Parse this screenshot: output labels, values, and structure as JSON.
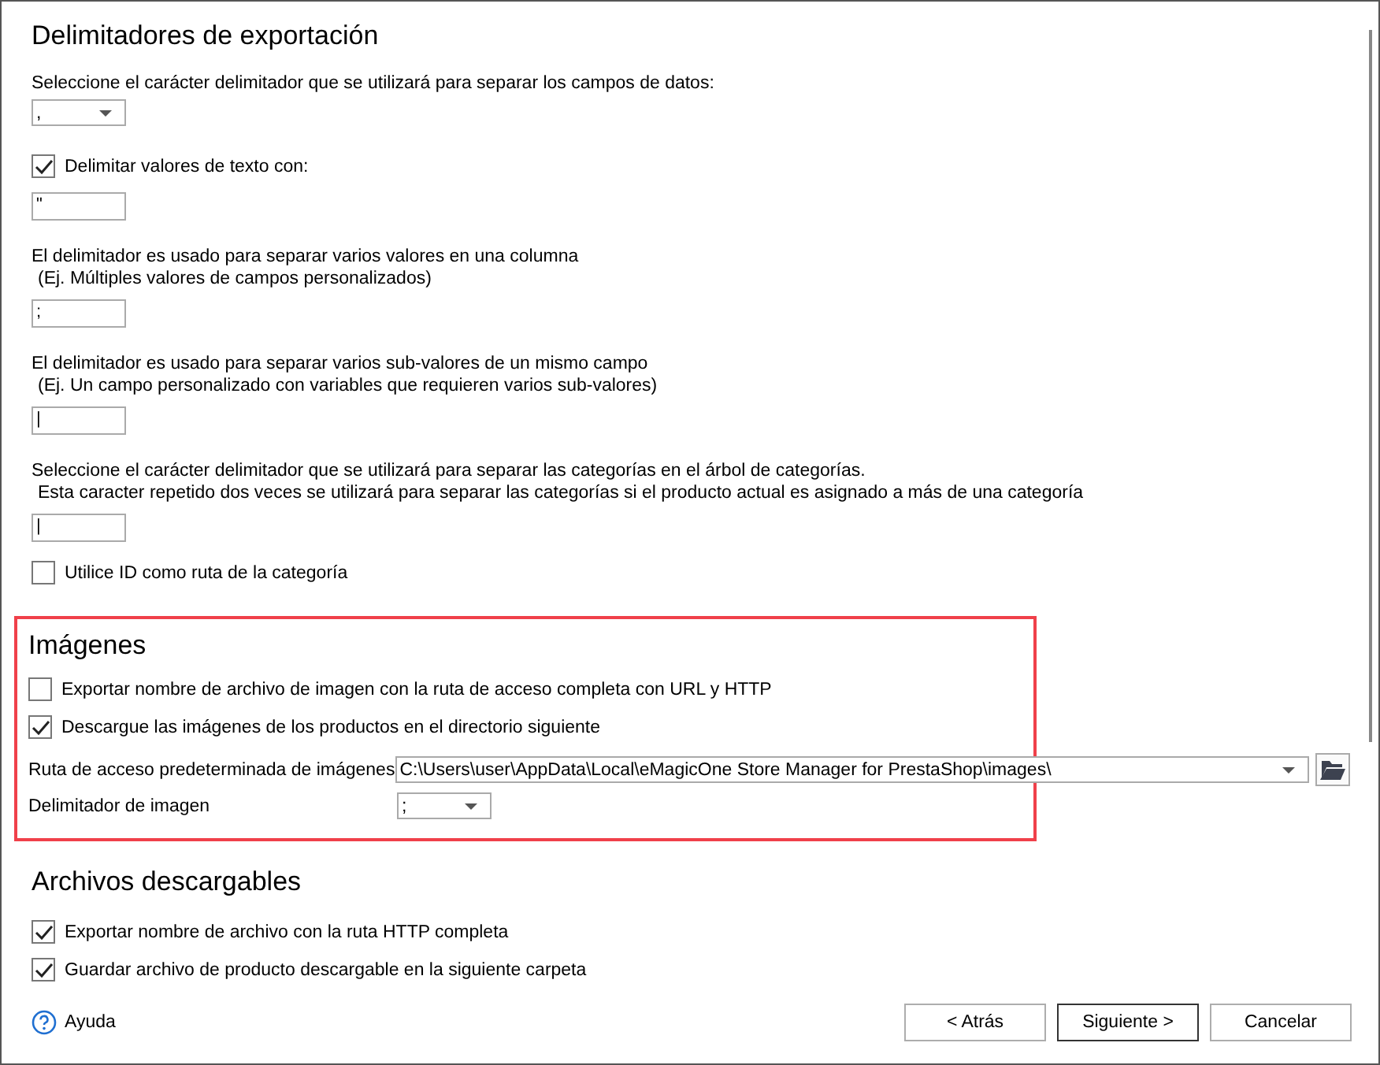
{
  "sections": [
    {
      "title": "Delimitadores de exportación",
      "highlighted": false,
      "items": [
        {
          "kind": "label",
          "text": "Seleccione el carácter delimitador que se utilizará para separar los campos de datos:"
        },
        {
          "kind": "combo",
          "value": ","
        },
        {
          "kind": "checkbox",
          "label": "Delimitar valores de texto con:",
          "checked": true
        },
        {
          "kind": "input",
          "value": "\""
        },
        {
          "kind": "note",
          "lines": [
            "El delimitador es usado para separar varios valores en una columna",
            "(Ej. Múltiples valores de campos personalizados)"
          ]
        },
        {
          "kind": "input",
          "value": ";"
        },
        {
          "kind": "note",
          "lines": [
            "El delimitador es usado para separar varios sub-valores de un mismo campo",
            "(Ej. Un campo personalizado con variables que requieren varios sub-valores)"
          ]
        },
        {
          "kind": "input",
          "value": "|"
        },
        {
          "kind": "note",
          "lines": [
            "Seleccione el carácter delimitador que se utilizará para separar las categorías en el árbol de categorías.",
            "Esta caracter repetido dos veces se utilizará para separar las categorías si el producto actual es asignado a más de una categoría"
          ]
        },
        {
          "kind": "input",
          "value": "|"
        },
        {
          "kind": "checkbox",
          "label": "Utilice ID como ruta de la categoría",
          "checked": false
        }
      ]
    },
    {
      "title": "Imágenes",
      "highlighted": true,
      "items": [
        {
          "kind": "checkbox",
          "label": "Exportar nombre de archivo de imagen con la ruta de acceso completa con URL y HTTP",
          "checked": false
        },
        {
          "kind": "checkbox",
          "label": "Descargue las imágenes de los productos en el directorio siguiente",
          "checked": true
        },
        {
          "kind": "path",
          "label": "Ruta de acceso predeterminada de imágenes",
          "value": "C:\\Users\\user\\AppData\\Local\\eMagicOne Store Manager for PrestaShop\\images\\"
        },
        {
          "kind": "labeled-combo",
          "label": "Delimitador de imagen",
          "value": ";"
        }
      ]
    },
    {
      "title": "Archivos descargables",
      "highlighted": false,
      "items": [
        {
          "kind": "checkbox",
          "label": "Exportar nombre de archivo con la ruta HTTP completa",
          "checked": true
        },
        {
          "kind": "checkbox",
          "label": "Guardar archivo de producto descargable en la siguiente carpeta",
          "checked": true
        }
      ]
    }
  ],
  "footer": {
    "help": "Ayuda",
    "buttons": [
      {
        "label": "< Atrás",
        "default": false
      },
      {
        "label": "Siguiente >",
        "default": true
      },
      {
        "label": "Cancelar",
        "default": false
      }
    ]
  }
}
